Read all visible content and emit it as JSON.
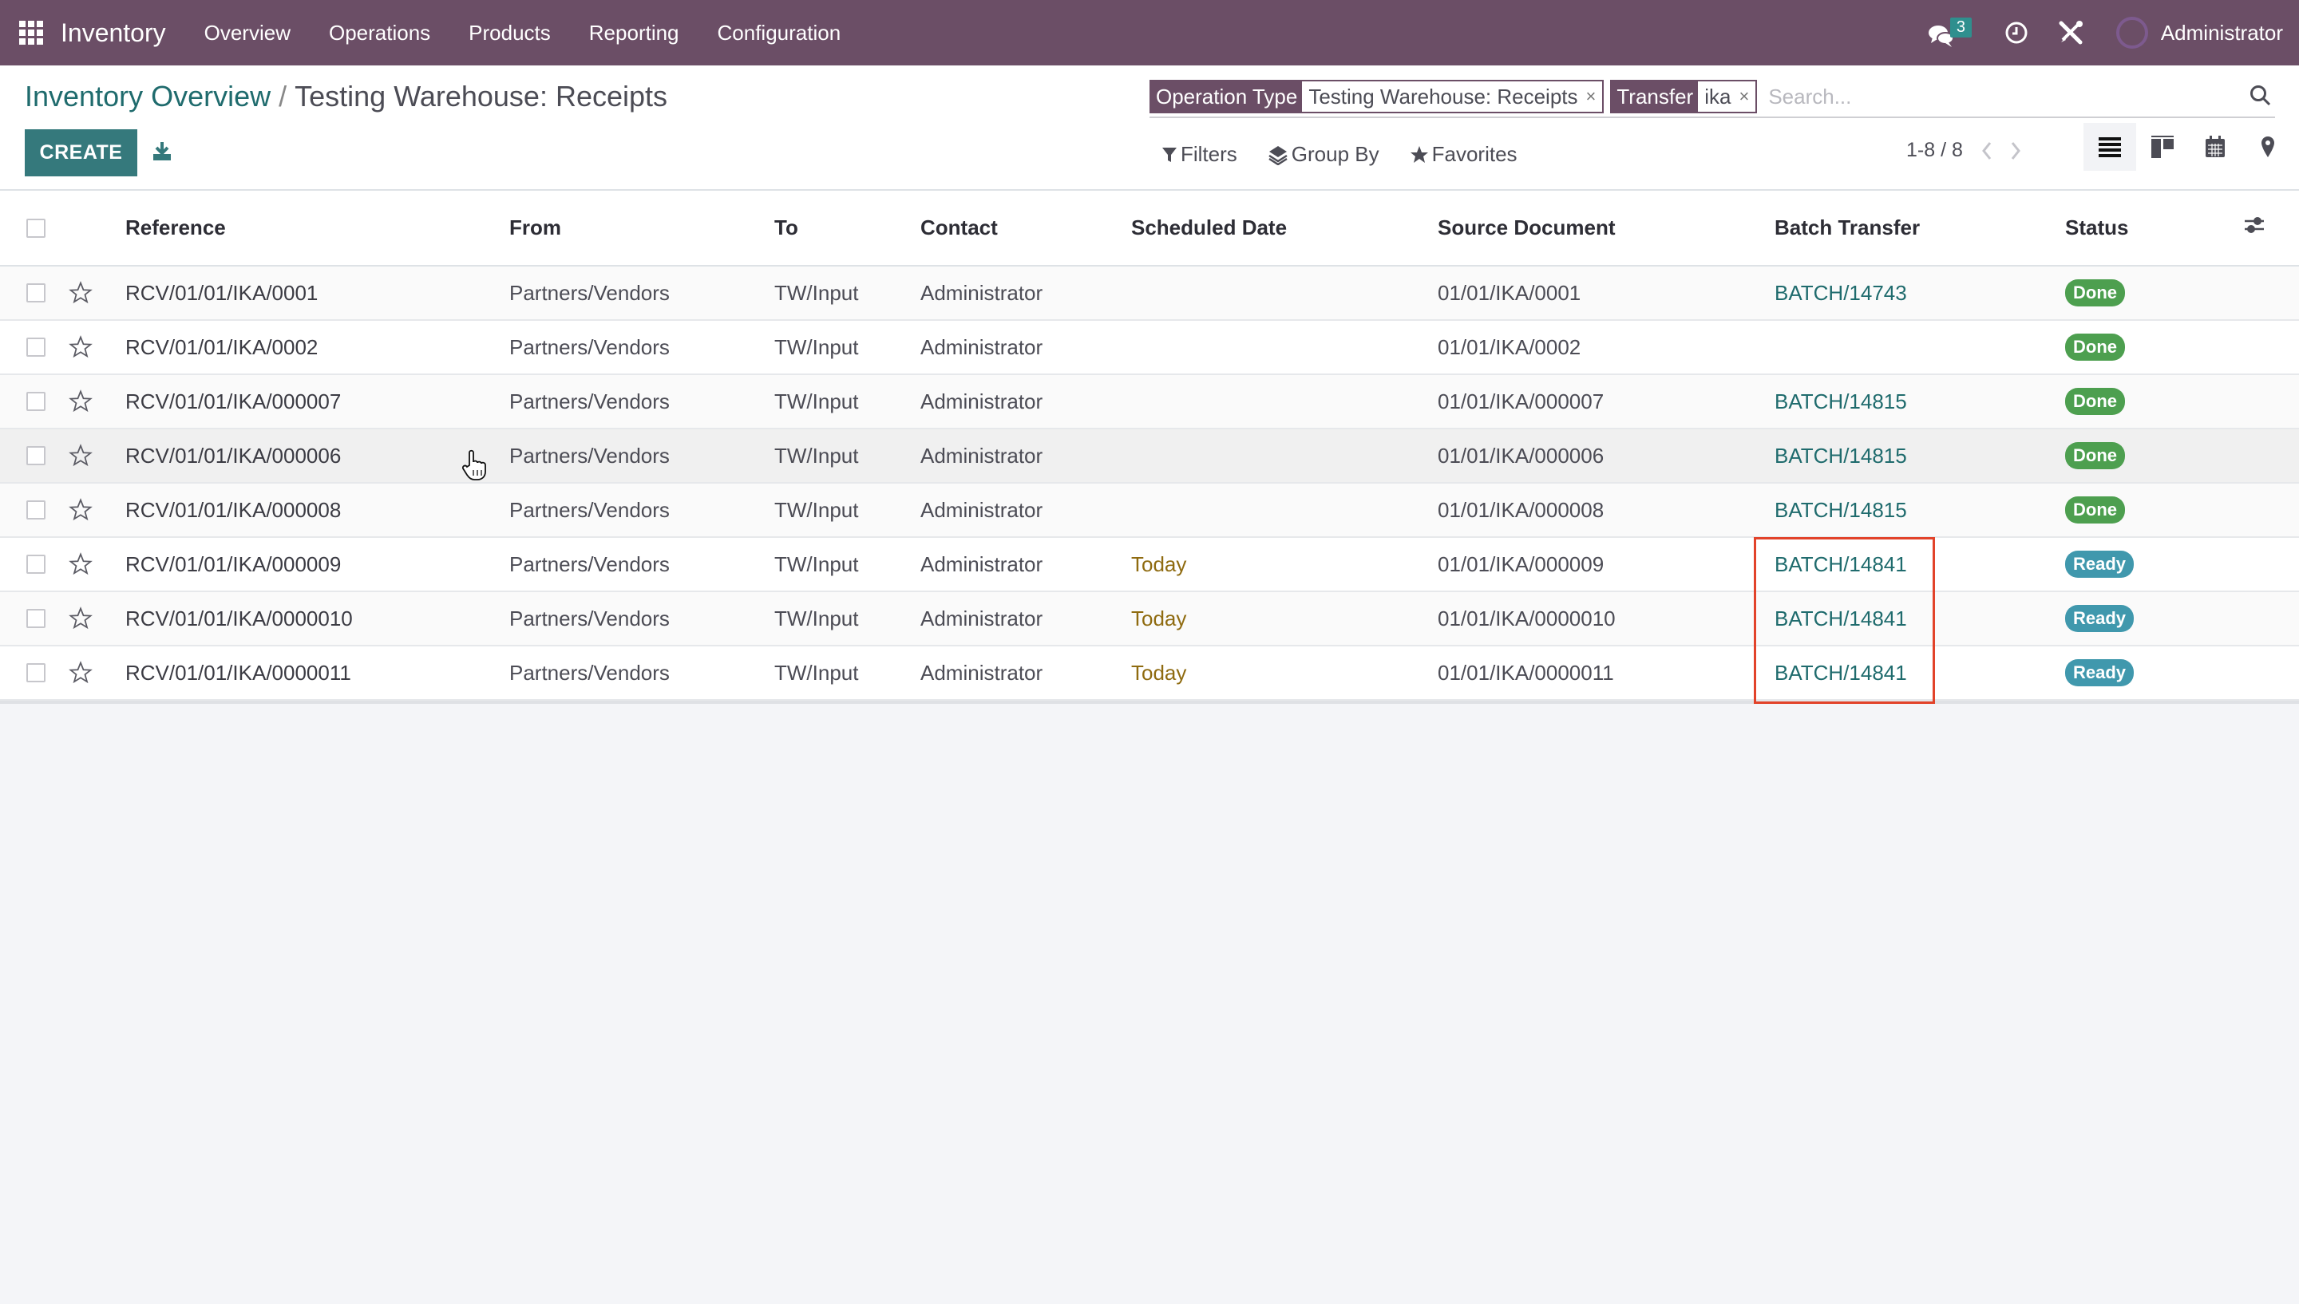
{
  "navbar": {
    "app_name": "Inventory",
    "menu": [
      "Overview",
      "Operations",
      "Products",
      "Reporting",
      "Configuration"
    ],
    "messages_count": "3",
    "user": "Administrator"
  },
  "breadcrumb": {
    "parent": "Inventory Overview",
    "separator": "/",
    "current": "Testing Warehouse: Receipts"
  },
  "toolbar": {
    "create_label": "CREATE"
  },
  "search": {
    "facets": [
      {
        "name": "Operation Type",
        "value": "Testing Warehouse: Receipts"
      },
      {
        "name": "Transfer",
        "value": "ika"
      }
    ],
    "placeholder": "Search...",
    "close_glyph": "×"
  },
  "filters": {
    "filters_label": "Filters",
    "groupby_label": "Group By",
    "favorites_label": "Favorites"
  },
  "pager": {
    "value": "1-8 / 8"
  },
  "views": [
    "list",
    "kanban",
    "calendar",
    "map"
  ],
  "table": {
    "columns": [
      "Reference",
      "From",
      "To",
      "Contact",
      "Scheduled Date",
      "Source Document",
      "Batch Transfer",
      "Status"
    ],
    "rows": [
      {
        "reference": "RCV/01/01/IKA/0001",
        "from": "Partners/Vendors",
        "to": "TW/Input",
        "contact": "Administrator",
        "scheduled": "",
        "source": "01/01/IKA/0001",
        "batch": "BATCH/14743",
        "status": "Done"
      },
      {
        "reference": "RCV/01/01/IKA/0002",
        "from": "Partners/Vendors",
        "to": "TW/Input",
        "contact": "Administrator",
        "scheduled": "",
        "source": "01/01/IKA/0002",
        "batch": "",
        "status": "Done"
      },
      {
        "reference": "RCV/01/01/IKA/000007",
        "from": "Partners/Vendors",
        "to": "TW/Input",
        "contact": "Administrator",
        "scheduled": "",
        "source": "01/01/IKA/000007",
        "batch": "BATCH/14815",
        "status": "Done"
      },
      {
        "reference": "RCV/01/01/IKA/000006",
        "from": "Partners/Vendors",
        "to": "TW/Input",
        "contact": "Administrator",
        "scheduled": "",
        "source": "01/01/IKA/000006",
        "batch": "BATCH/14815",
        "status": "Done"
      },
      {
        "reference": "RCV/01/01/IKA/000008",
        "from": "Partners/Vendors",
        "to": "TW/Input",
        "contact": "Administrator",
        "scheduled": "",
        "source": "01/01/IKA/000008",
        "batch": "BATCH/14815",
        "status": "Done"
      },
      {
        "reference": "RCV/01/01/IKA/000009",
        "from": "Partners/Vendors",
        "to": "TW/Input",
        "contact": "Administrator",
        "scheduled": "Today",
        "source": "01/01/IKA/000009",
        "batch": "BATCH/14841",
        "status": "Ready"
      },
      {
        "reference": "RCV/01/01/IKA/0000010",
        "from": "Partners/Vendors",
        "to": "TW/Input",
        "contact": "Administrator",
        "scheduled": "Today",
        "source": "01/01/IKA/0000010",
        "batch": "BATCH/14841",
        "status": "Ready"
      },
      {
        "reference": "RCV/01/01/IKA/0000011",
        "from": "Partners/Vendors",
        "to": "TW/Input",
        "contact": "Administrator",
        "scheduled": "Today",
        "source": "01/01/IKA/0000011",
        "batch": "BATCH/14841",
        "status": "Ready"
      }
    ]
  },
  "colors": {
    "navbar": "#6b4e66",
    "primary": "#35797c",
    "link": "#1f6b6d",
    "done": "#4d9f4f",
    "ready": "#4098ad",
    "today": "#8f6b10",
    "highlight": "#e2432a"
  }
}
